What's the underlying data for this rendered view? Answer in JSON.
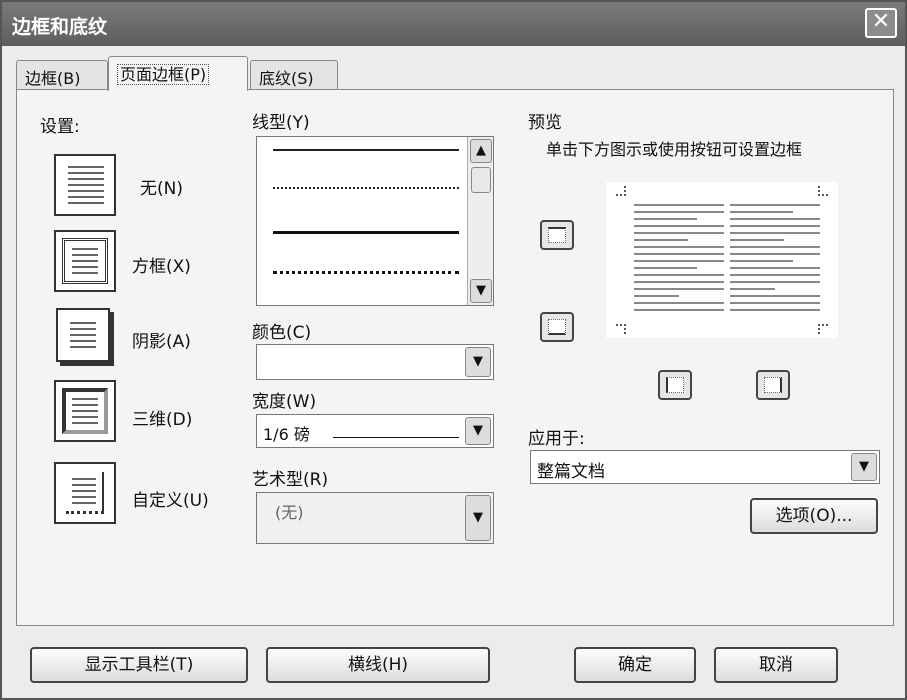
{
  "window": {
    "title": "边框和底纹",
    "close_glyph": "✕"
  },
  "tabs": [
    {
      "label": "边框(B)"
    },
    {
      "label": "页面边框(P)"
    },
    {
      "label": "底纹(S)"
    }
  ],
  "settings": {
    "heading": "设置:",
    "items": [
      {
        "label": "无(N)",
        "icon": "page-none-icon"
      },
      {
        "label": "方框(X)",
        "icon": "page-box-icon"
      },
      {
        "label": "阴影(A)",
        "icon": "page-shadow-icon"
      },
      {
        "label": "三维(D)",
        "icon": "page-3d-icon"
      },
      {
        "label": "自定义(U)",
        "icon": "page-custom-icon"
      }
    ]
  },
  "line_style": {
    "label": "线型(Y)"
  },
  "color": {
    "label": "颜色(C)",
    "value": ""
  },
  "width": {
    "label": "宽度(W)",
    "value": "1/6 磅"
  },
  "art": {
    "label": "艺术型(R)",
    "value": "(无)"
  },
  "preview": {
    "heading": "预览",
    "hint": "单击下方图示或使用按钮可设置边框"
  },
  "apply_to": {
    "label": "应用于:",
    "value": "整篇文档"
  },
  "buttons": {
    "options": "选项(O)...",
    "show_toolbar": "显示工具栏(T)",
    "horizontal_line": "横线(H)",
    "ok": "确定",
    "cancel": "取消"
  },
  "colors": {
    "titlebar": "#666666",
    "dialog_bg": "#ececec"
  }
}
